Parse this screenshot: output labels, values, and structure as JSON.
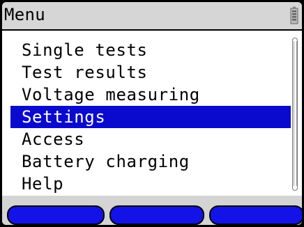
{
  "header": {
    "title": "Menu",
    "battery_icon": "battery-icon"
  },
  "menu": {
    "items": [
      {
        "label": "Single tests",
        "selected": false
      },
      {
        "label": "Test results",
        "selected": false
      },
      {
        "label": "Voltage measuring",
        "selected": false
      },
      {
        "label": "Settings",
        "selected": true
      },
      {
        "label": "Access",
        "selected": false
      },
      {
        "label": "Battery charging",
        "selected": false
      },
      {
        "label": "Help",
        "selected": false
      }
    ],
    "selection_color": "#0a0acf"
  },
  "softkeys": {
    "color": "#1313e8",
    "keys": [
      {
        "label": ""
      },
      {
        "label": ""
      },
      {
        "label": ""
      }
    ]
  }
}
